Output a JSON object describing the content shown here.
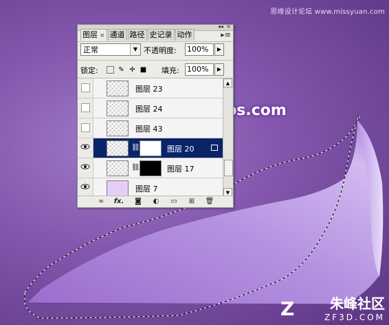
{
  "watermarks": {
    "top_right": "思缘设计论坛 www.missyuan.com",
    "middle": "www.68ps.com",
    "bottom_cn": "朱峰社区",
    "bottom_en": "ZF3D.COM"
  },
  "panel": {
    "tabs": [
      {
        "label": "图层",
        "close": "×"
      },
      {
        "label": "通道"
      },
      {
        "label": "路径"
      },
      {
        "label": "史记录"
      },
      {
        "label": "动作"
      }
    ],
    "blend_mode": "正常",
    "opacity_label": "不透明度:",
    "opacity_value": "100%",
    "lock_label": "锁定:",
    "fill_label": "填充:",
    "fill_value": "100%",
    "layers": [
      {
        "name": "图层 23",
        "visible": false,
        "selected": false,
        "has_mask": false
      },
      {
        "name": "图层 24",
        "visible": false,
        "selected": false,
        "has_mask": false
      },
      {
        "name": "图层 43",
        "visible": false,
        "selected": false,
        "has_mask": false
      },
      {
        "name": "图层 20",
        "visible": true,
        "selected": true,
        "has_mask": true,
        "mask_color": "white"
      },
      {
        "name": "图层 17",
        "visible": true,
        "selected": false,
        "has_mask": true,
        "mask_color": "black"
      },
      {
        "name": "图层 7",
        "visible": true,
        "selected": false,
        "has_mask": false
      }
    ]
  },
  "colors": {
    "selection": "#0a246a",
    "petal_light": "#d9c0f0",
    "petal_dark": "#8e5fc2"
  }
}
